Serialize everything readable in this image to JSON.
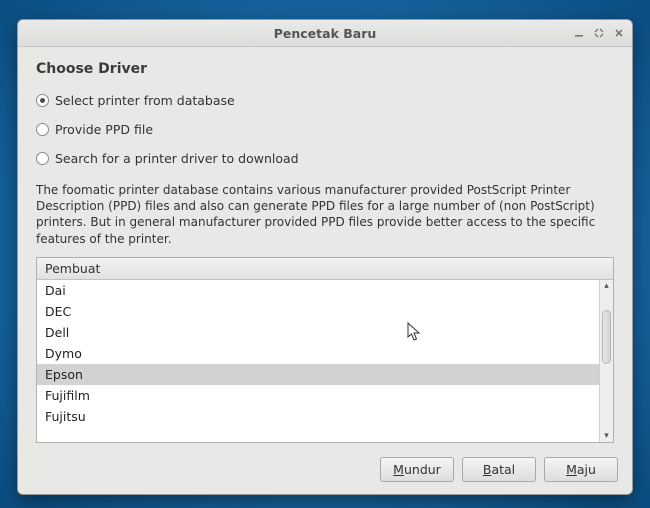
{
  "window": {
    "title": "Pencetak Baru"
  },
  "heading": "Choose Driver",
  "options": {
    "from_database": "Select printer from database",
    "provide_ppd": "Provide PPD file",
    "search_download": "Search for a printer driver to download",
    "selected": "from_database"
  },
  "description": "The foomatic printer database contains various manufacturer provided PostScript Printer Description (PPD) files and also can generate PPD files for a large number of (non PostScript) printers. But in general manufacturer provided PPD files provide better access to the specific features of the printer.",
  "list": {
    "column_header": "Pembuat",
    "items": [
      "Dai",
      "DEC",
      "Dell",
      "Dymo",
      "Epson",
      "Fujifilm",
      "Fujitsu"
    ],
    "selected_index": 4
  },
  "buttons": {
    "back": "Mundur",
    "cancel": "Batal",
    "forward": "Maju"
  }
}
